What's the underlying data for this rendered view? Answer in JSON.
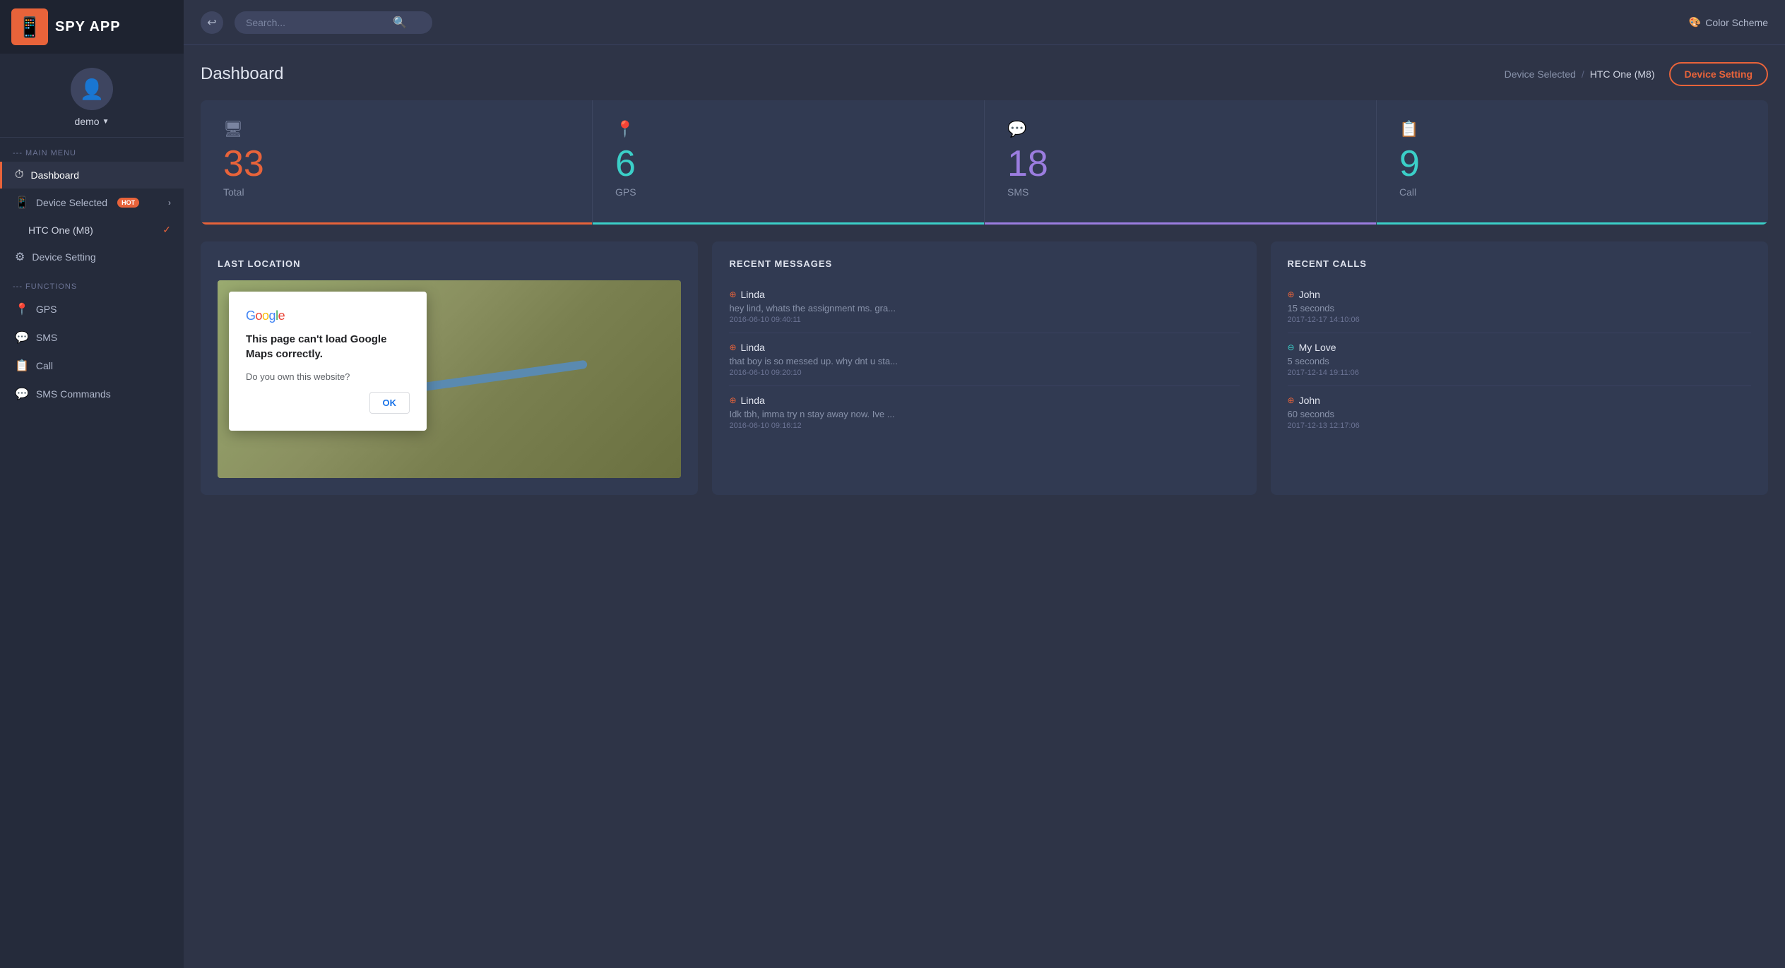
{
  "sidebar": {
    "logo_text": "SPY APP",
    "username": "demo",
    "main_menu_label": "--- MAIN MENU",
    "items": [
      {
        "id": "dashboard",
        "label": "Dashboard",
        "icon": "⏱",
        "active": true
      },
      {
        "id": "device-selected",
        "label": "Device Selected",
        "icon": "📱",
        "badge": "HOT",
        "has_chevron": true
      },
      {
        "id": "device-setting",
        "label": "Device Setting",
        "icon": "⚙"
      }
    ],
    "sub_items": [
      {
        "id": "htc-one",
        "label": "HTC One (M8)",
        "checked": true
      }
    ],
    "functions_label": "--- FUNCTIONS",
    "function_items": [
      {
        "id": "gps",
        "label": "GPS",
        "icon": "📍"
      },
      {
        "id": "sms",
        "label": "SMS",
        "icon": "💬"
      },
      {
        "id": "call",
        "label": "Call",
        "icon": "📋"
      },
      {
        "id": "sms-commands",
        "label": "SMS Commands",
        "icon": "💬"
      }
    ]
  },
  "topbar": {
    "search_placeholder": "Search...",
    "color_scheme_label": "Color Scheme",
    "back_icon": "↩"
  },
  "header": {
    "title": "Dashboard",
    "breadcrumb_device_selected": "Device Selected",
    "breadcrumb_separator": "/",
    "breadcrumb_device_name": "HTC One (M8)",
    "device_setting_button": "Device Setting"
  },
  "stats": [
    {
      "id": "total",
      "icon": "🖥",
      "value": "33",
      "label": "Total",
      "color": "orange"
    },
    {
      "id": "gps",
      "icon": "📍",
      "value": "6",
      "label": "GPS",
      "color": "teal"
    },
    {
      "id": "sms",
      "icon": "💬",
      "value": "18",
      "label": "SMS",
      "color": "purple"
    },
    {
      "id": "call",
      "icon": "📋",
      "value": "9",
      "label": "Call",
      "color": "green"
    }
  ],
  "last_location": {
    "title": "LAST LOCATION",
    "map_dialog": {
      "logo": "Google",
      "title": "This page can't load Google Maps correctly.",
      "question": "Do you own this website?",
      "ok_button": "OK"
    }
  },
  "recent_messages": {
    "title": "RECENT MESSAGES",
    "items": [
      {
        "name": "Linda",
        "direction": "out",
        "text": "hey lind, whats the assignment ms. gra...",
        "time": "2016-06-10 09:40:11"
      },
      {
        "name": "Linda",
        "direction": "out",
        "text": "that boy is so messed up. why dnt u sta...",
        "time": "2016-06-10 09:20:10"
      },
      {
        "name": "Linda",
        "direction": "out",
        "text": "Idk tbh, imma try n stay away now. Ive ...",
        "time": "2016-06-10 09:16:12"
      }
    ]
  },
  "recent_calls": {
    "title": "RECENT CALLS",
    "items": [
      {
        "name": "John",
        "direction": "out",
        "duration": "15 seconds",
        "time": "2017-12-17 14:10:06"
      },
      {
        "name": "My Love",
        "direction": "in",
        "duration": "5 seconds",
        "time": "2017-12-14 19:11:06"
      },
      {
        "name": "John",
        "direction": "out",
        "duration": "60 seconds",
        "time": "2017-12-13 12:17:06"
      }
    ]
  }
}
